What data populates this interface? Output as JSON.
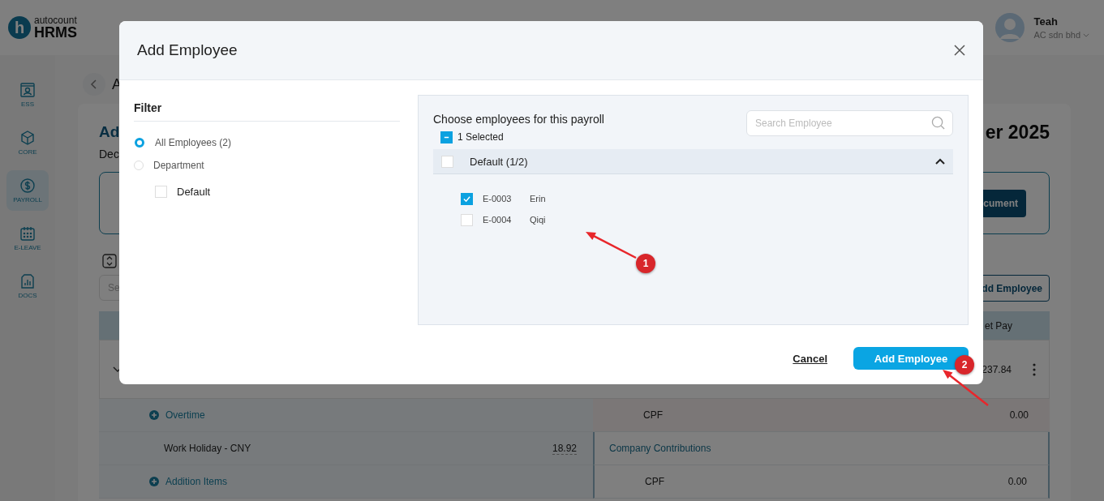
{
  "header": {
    "logo": {
      "mark": "h",
      "brand": "autocount",
      "product": "HRMS"
    },
    "user": {
      "name": "Teah",
      "company": "AC sdn bhd"
    }
  },
  "sidebar": {
    "items": [
      {
        "label": "ESS",
        "kind": "person",
        "selected": false
      },
      {
        "label": "CORE",
        "kind": "cube",
        "selected": false
      },
      {
        "label": "PAYROLL",
        "kind": "dollar",
        "selected": true
      },
      {
        "label": "E-LEAVE",
        "kind": "calendar",
        "selected": false
      },
      {
        "label": "DOCS",
        "kind": "chart",
        "selected": false
      }
    ]
  },
  "page": {
    "back_title": "A",
    "title_start": "Ad",
    "title_end": "er 2025",
    "subtitle": "Dec",
    "document_button": "cument",
    "search_placeholder": "Se",
    "add_button": "dd Employee",
    "table": {
      "net_pay_header": "et Pay",
      "net_pay": "237.84",
      "left_rows": [
        {
          "kind": "section",
          "label": "Overtime"
        },
        {
          "kind": "item",
          "label": "Work Holiday - CNY",
          "value": "18.92"
        },
        {
          "kind": "section",
          "label": "Addition Items"
        }
      ],
      "right_rows": [
        {
          "kind": "deduction",
          "label": "CPF",
          "value": "0.00"
        },
        {
          "kind": "heading",
          "label": "Company Contributions"
        },
        {
          "kind": "contribution",
          "label": "CPF",
          "value": "0.00"
        }
      ]
    }
  },
  "modal": {
    "title": "Add Employee",
    "filter": {
      "title": "Filter",
      "options": [
        {
          "label": "All Employees (2)",
          "selected": true
        },
        {
          "label": "Department",
          "selected": false
        }
      ],
      "departments": [
        {
          "label": "Default",
          "checked": false
        }
      ]
    },
    "chooser": {
      "title": "Choose employees for this payroll",
      "search_placeholder": "Search Employee",
      "select_all": {
        "label": "1 Selected",
        "partial": true
      },
      "groups": [
        {
          "label": "Default (1/2)",
          "checked": false,
          "expanded": true,
          "employees": [
            {
              "code": "E-0003",
              "name": "Erin",
              "checked": true
            },
            {
              "code": "E-0004",
              "name": "Qiqi",
              "checked": false
            }
          ]
        }
      ]
    },
    "buttons": [
      {
        "label": "Cancel",
        "kind": "link"
      },
      {
        "label": "Add Employee",
        "kind": "primary"
      }
    ]
  },
  "annotations": [
    {
      "label": "1"
    },
    {
      "label": "2"
    }
  ]
}
